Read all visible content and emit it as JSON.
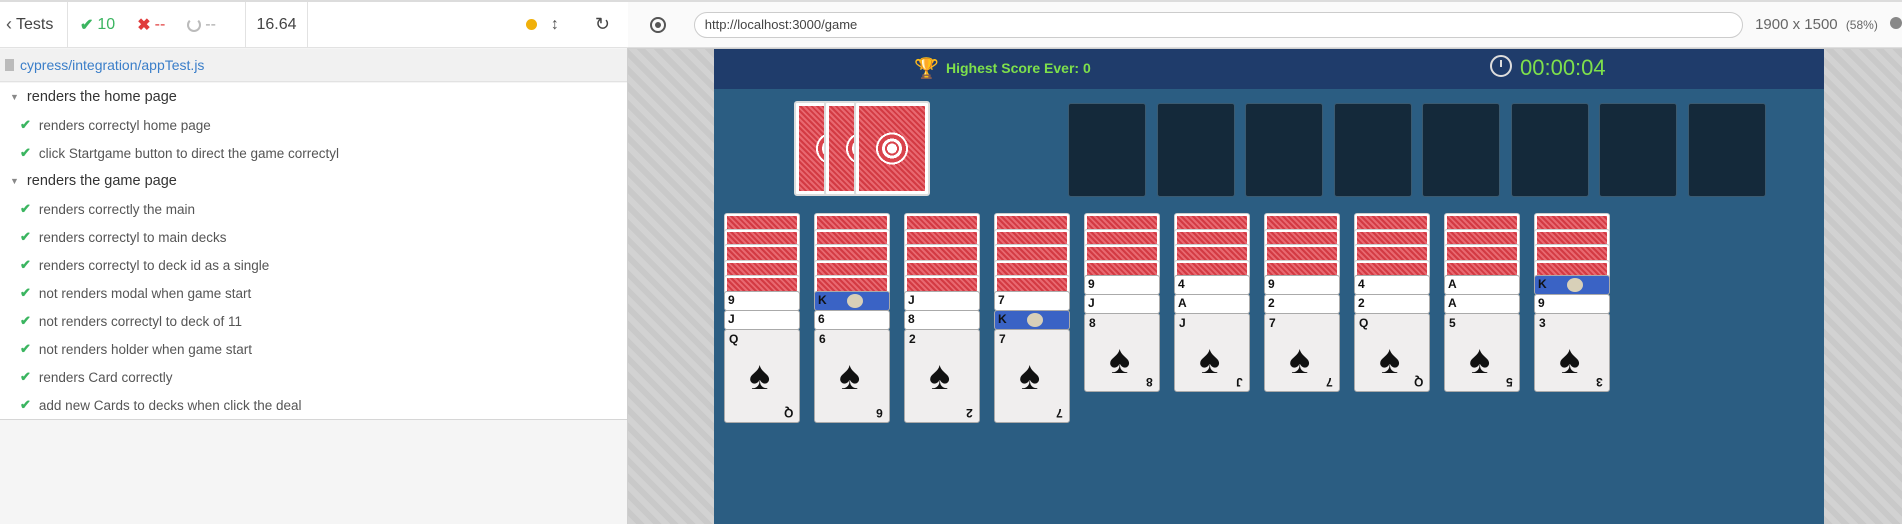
{
  "reporter": {
    "tests_label": "Tests",
    "passed": "10",
    "failed": "--",
    "pending": "--",
    "duration": "16.64",
    "spec_file": "cypress/integration/appTest.js",
    "suites": [
      {
        "title": "renders the home page",
        "tests": [
          "renders correctyl home page",
          "click Startgame button to direct the game correctyl"
        ]
      },
      {
        "title": "renders the game page",
        "tests": [
          "renders correctly the main",
          "renders correctyl to main decks",
          "renders correctyl to deck id as a single",
          "not renders modal when game start",
          "not renders correctyl to deck of 11",
          "not renders holder when game start",
          "renders Card correctly",
          "add new Cards to decks when click the deal"
        ]
      }
    ]
  },
  "browser": {
    "url": "http://localhost:3000/game",
    "viewport": "1900 x 1500",
    "zoom": "(58%)"
  },
  "game": {
    "high_score": "Highest Score Ever: 0",
    "timer": "00:00:04",
    "columns": [
      {
        "face_down": 5,
        "visible": [
          "9",
          "J"
        ],
        "top": "Q"
      },
      {
        "face_down": 5,
        "visible": [
          "K",
          "6"
        ],
        "top": "6"
      },
      {
        "face_down": 5,
        "visible": [
          "J",
          "8"
        ],
        "top": "2"
      },
      {
        "face_down": 5,
        "visible": [
          "7",
          "K"
        ],
        "top": "7"
      },
      {
        "face_down": 4,
        "visible": [
          "9",
          "J"
        ],
        "top": "8"
      },
      {
        "face_down": 4,
        "visible": [
          "4",
          "A"
        ],
        "top": "J"
      },
      {
        "face_down": 4,
        "visible": [
          "9",
          "2"
        ],
        "top": "7"
      },
      {
        "face_down": 4,
        "visible": [
          "4",
          "2"
        ],
        "top": "Q"
      },
      {
        "face_down": 4,
        "visible": [
          "A",
          "A"
        ],
        "top": "5"
      },
      {
        "face_down": 4,
        "visible": [
          "K",
          "9"
        ],
        "top": "3"
      }
    ],
    "kings": [
      [
        1,
        0
      ],
      [
        3,
        1
      ],
      [
        9,
        0
      ]
    ],
    "colors": {
      "header": "#1f3c6b",
      "table": "#2b5d82",
      "accent_green": "#7ee04b",
      "card_back": "#d33a43"
    }
  }
}
